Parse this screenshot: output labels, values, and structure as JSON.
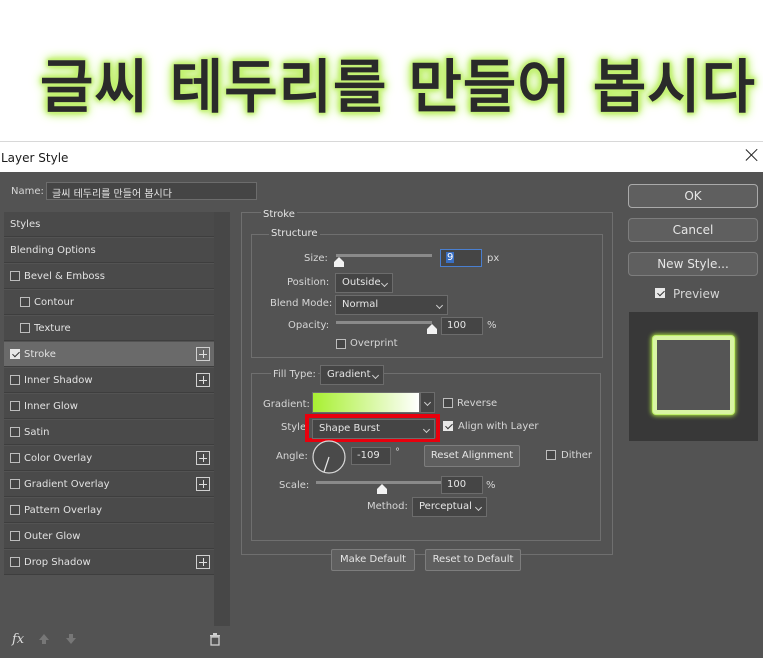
{
  "banner": {
    "title": "글씨 테두리를 만들어 봅시다"
  },
  "window": {
    "title": "Layer Style"
  },
  "name_field": {
    "label": "Name:",
    "value": "글씨 테두리를 만들어 봅시다"
  },
  "styles_list": [
    {
      "label": "Styles",
      "checkbox": false,
      "checked": false,
      "plus": false,
      "indent": false,
      "selected": false
    },
    {
      "label": "Blending Options",
      "checkbox": false,
      "checked": false,
      "plus": false,
      "indent": false,
      "selected": false
    },
    {
      "label": "Bevel & Emboss",
      "checkbox": true,
      "checked": false,
      "plus": false,
      "indent": false,
      "selected": false
    },
    {
      "label": "Contour",
      "checkbox": true,
      "checked": false,
      "plus": false,
      "indent": true,
      "selected": false
    },
    {
      "label": "Texture",
      "checkbox": true,
      "checked": false,
      "plus": false,
      "indent": true,
      "selected": false
    },
    {
      "label": "Stroke",
      "checkbox": true,
      "checked": true,
      "plus": true,
      "indent": false,
      "selected": true
    },
    {
      "label": "Inner Shadow",
      "checkbox": true,
      "checked": false,
      "plus": true,
      "indent": false,
      "selected": false
    },
    {
      "label": "Inner Glow",
      "checkbox": true,
      "checked": false,
      "plus": false,
      "indent": false,
      "selected": false
    },
    {
      "label": "Satin",
      "checkbox": true,
      "checked": false,
      "plus": false,
      "indent": false,
      "selected": false
    },
    {
      "label": "Color Overlay",
      "checkbox": true,
      "checked": false,
      "plus": true,
      "indent": false,
      "selected": false
    },
    {
      "label": "Gradient Overlay",
      "checkbox": true,
      "checked": false,
      "plus": true,
      "indent": false,
      "selected": false
    },
    {
      "label": "Pattern Overlay",
      "checkbox": true,
      "checked": false,
      "plus": false,
      "indent": false,
      "selected": false
    },
    {
      "label": "Outer Glow",
      "checkbox": true,
      "checked": false,
      "plus": false,
      "indent": false,
      "selected": false
    },
    {
      "label": "Drop Shadow",
      "checkbox": true,
      "checked": false,
      "plus": true,
      "indent": false,
      "selected": false
    }
  ],
  "bottom_tools": {
    "fx_label": "fx",
    "icons": [
      "fx-icon",
      "move-up-icon",
      "move-down-icon",
      "trash-icon"
    ]
  },
  "stroke": {
    "section_title": "Stroke",
    "structure_title": "Structure",
    "size_label": "Size:",
    "size_value": "9",
    "size_unit": "px",
    "size_level": 0.03,
    "position_label": "Position:",
    "position_value": "Outside",
    "blend_mode_label": "Blend Mode:",
    "blend_mode_value": "Normal",
    "opacity_label": "Opacity:",
    "opacity_value": "100",
    "opacity_unit": "%",
    "opacity_level": 1.0,
    "overprint_label": "Overprint",
    "overprint_checked": false,
    "fill_type_label": "Fill Type:",
    "fill_type_value": "Gradient",
    "gradient_label": "Gradient:",
    "gradient_start": "#a8f032",
    "gradient_end": "#ffffff",
    "reverse_label": "Reverse",
    "reverse_checked": false,
    "style_label": "Style:",
    "style_value": "Shape Burst",
    "align_label": "Align with Layer",
    "align_checked": true,
    "angle_label": "Angle:",
    "angle_value": "-109",
    "angle_unit": "°",
    "reset_alignment_label": "Reset Alignment",
    "dither_label": "Dither",
    "dither_checked": false,
    "scale_label": "Scale:",
    "scale_value": "100",
    "scale_unit": "%",
    "scale_level": 0.5,
    "method_label": "Method:",
    "method_value": "Perceptual",
    "make_default_label": "Make Default",
    "reset_default_label": "Reset to Default"
  },
  "right_panel": {
    "ok_label": "OK",
    "cancel_label": "Cancel",
    "new_style_label": "New Style...",
    "preview_label": "Preview",
    "preview_checked": true
  },
  "colors": {
    "highlight": "#e8000d",
    "glow": "#c6f27a",
    "dialog_bg": "#535353"
  }
}
